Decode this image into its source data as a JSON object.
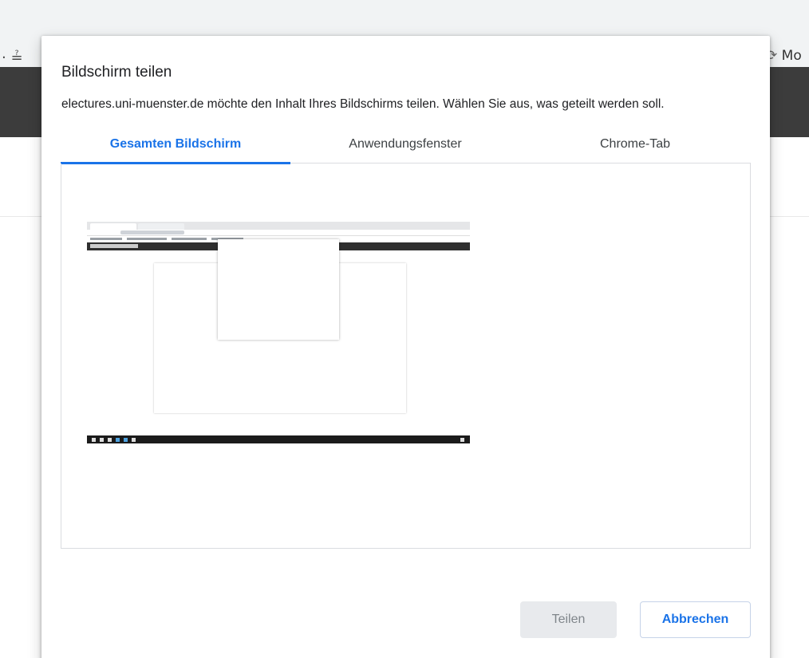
{
  "background": {
    "left_glyph": "⋅ ≟",
    "right_glyph_icon": "sync-icon",
    "right_text": "Mo",
    "toolbar_color": "#f1f3f4",
    "darkbar_color": "#3c3c3c"
  },
  "dialog": {
    "title": "Bildschirm teilen",
    "subtitle": "electures.uni-muenster.de möchte den Inhalt Ihres Bildschirms teilen. Wählen Sie aus, was geteilt werden soll.",
    "tabs": [
      {
        "label": "Gesamten Bildschirm",
        "active": true
      },
      {
        "label": "Anwendungsfenster",
        "active": false
      },
      {
        "label": "Chrome-Tab",
        "active": false
      }
    ],
    "share_button": "Teilen",
    "cancel_button": "Abbrechen",
    "accent_color": "#1a73e8"
  }
}
